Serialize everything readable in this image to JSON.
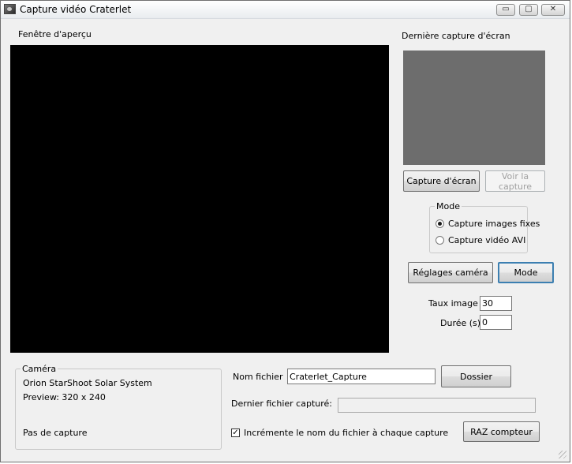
{
  "window": {
    "title": "Capture vidéo Craterlet",
    "controls": {
      "minimize": "▭",
      "maximize": "▢",
      "close": "✕"
    }
  },
  "preview": {
    "label": "Fenêtre d'aperçu"
  },
  "last_capture": {
    "label": "Dernière capture d'écran"
  },
  "buttons": {
    "capture_screen": "Capture d'écran",
    "view_capture": "Voir la capture",
    "camera_settings": "Réglages caméra",
    "mode": "Mode",
    "folder": "Dossier",
    "reset_counter": "RAZ compteur"
  },
  "mode_group": {
    "title": "Mode",
    "options": [
      {
        "label": "Capture images fixes",
        "checked": true
      },
      {
        "label": "Capture vidéo AVI",
        "checked": false
      }
    ]
  },
  "frame_rate": {
    "label": "Taux image",
    "value": "30"
  },
  "duration": {
    "label": "Durée (s)",
    "value": "0"
  },
  "camera_group": {
    "title": "Caméra",
    "name": "Orion StarShoot Solar System",
    "preview_size": "Preview: 320 x 240",
    "status": "Pas de capture"
  },
  "filename": {
    "label": "Nom fichier",
    "value": "Craterlet_Capture"
  },
  "last_file": {
    "label": "Dernier fichier capturé:",
    "value": ""
  },
  "increment": {
    "label": "Incrémente le nom du fichier à chaque capture",
    "checked": true,
    "mark": "✓"
  }
}
